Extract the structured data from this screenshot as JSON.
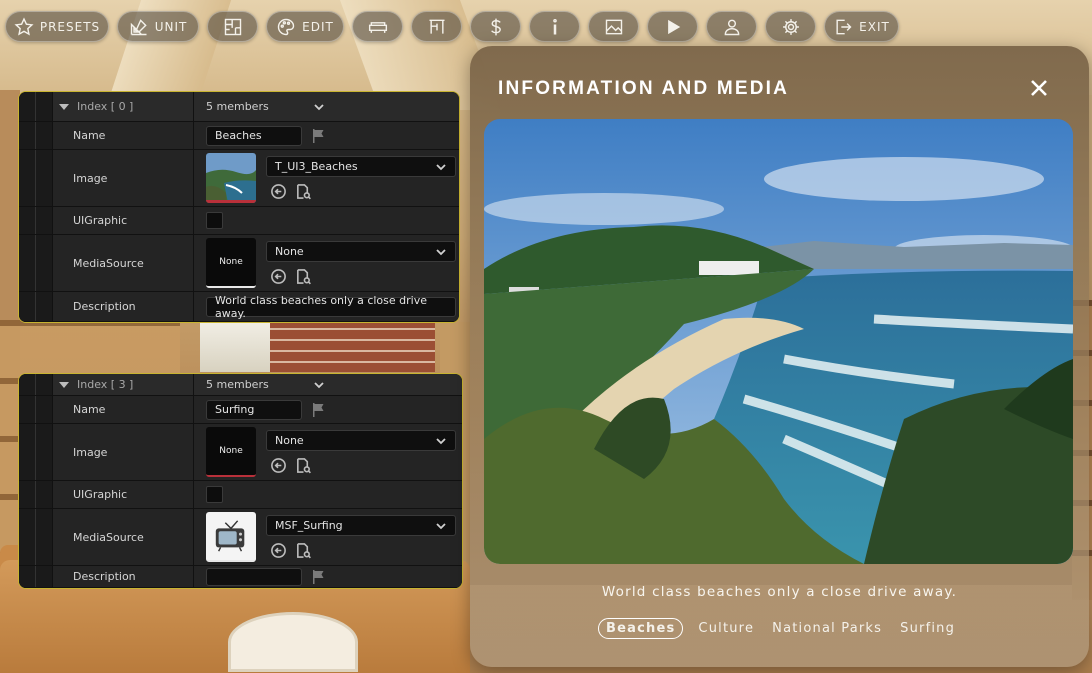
{
  "toolbar": {
    "presets": "PRESETS",
    "unit": "UNIT",
    "edit": "EDIT",
    "exit": "EXIT",
    "icons": [
      "star-icon",
      "ruler-pencil-icon",
      "floorplan-icon",
      "palette-icon",
      "sofa-icon",
      "measure-icon",
      "dollar-icon",
      "info-icon",
      "image-icon",
      "play-icon",
      "user-icon",
      "gear-icon",
      "exit-icon"
    ]
  },
  "editor": {
    "entries": [
      {
        "index_label": "Index [ 0 ]",
        "members": "5 members",
        "name_label": "Name",
        "name_value": "Beaches",
        "image_label": "Image",
        "image_asset": "T_UI3_Beaches",
        "uigraphic_label": "UIGraphic",
        "mediasource_label": "MediaSource",
        "mediasource_thumb": "None",
        "mediasource_asset": "None",
        "description_label": "Description",
        "description_value": "World class beaches only a close drive away."
      },
      {
        "index_label": "Index [ 3 ]",
        "members": "5 members",
        "name_label": "Name",
        "name_value": "Surfing",
        "image_label": "Image",
        "image_thumb": "None",
        "image_asset": "None",
        "uigraphic_label": "UIGraphic",
        "mediasource_label": "MediaSource",
        "mediasource_asset": "MSF_Surfing",
        "description_label": "Description",
        "description_value": ""
      }
    ]
  },
  "info_panel": {
    "title": "INFORMATION AND MEDIA",
    "description": "World class beaches only a close drive away.",
    "tabs": [
      {
        "label": "Beaches",
        "active": true
      },
      {
        "label": "Culture",
        "active": false
      },
      {
        "label": "National Parks",
        "active": false
      },
      {
        "label": "Surfing",
        "active": false
      }
    ]
  },
  "colors": {
    "panel_border": "#c8b431",
    "panel_bg": "#1c1c1c",
    "info_bg": "#7a6246"
  }
}
